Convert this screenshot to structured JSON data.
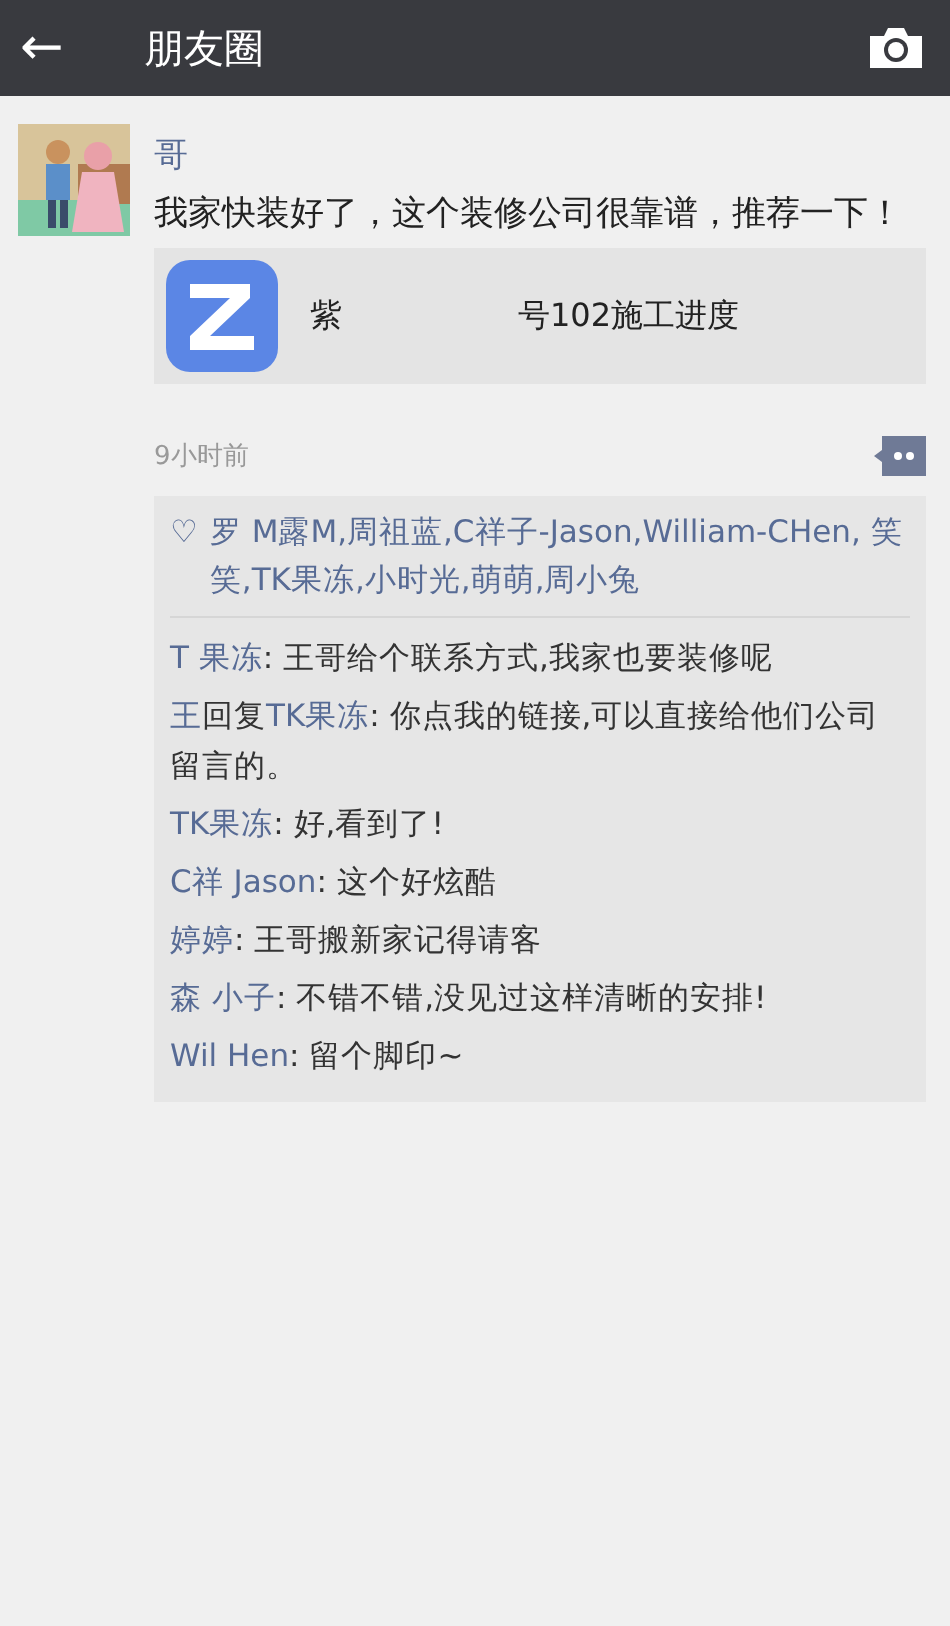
{
  "header": {
    "back": "←",
    "title": "朋友圈"
  },
  "post": {
    "author": "哥",
    "text": "我家快装好了，这个装修公司很靠谱，推荐一下！",
    "link": {
      "title_parts": [
        "紫",
        "号102施工进度"
      ]
    },
    "time": "9小时前"
  },
  "likes": {
    "icon": "♡",
    "names": "罗 M露M,周祖蓝,C祥子-Jason,William-CHen, 笑笑,TK果冻,小时光,萌萌,周小兔"
  },
  "comments": [
    {
      "name": "T 果冻",
      "text": ": 王哥给个联系方式,我家也要装修呢"
    },
    {
      "name": "王",
      "reply_word": "回复",
      "reply_to": "TK果冻",
      "text": ": 你点我的链接,可以直接给他们公司留言的。"
    },
    {
      "name": "TK果冻",
      "text": ": 好,看到了!"
    },
    {
      "name": "C祥 Jason",
      "text": ": 这个好炫酷"
    },
    {
      "name": "婷婷",
      "text": ": 王哥搬新家记得请客"
    },
    {
      "name": "森 小子",
      "text": ": 不错不错,没见过这样清晰的安排!"
    },
    {
      "name": "Wil Hen",
      "text": ": 留个脚印~"
    }
  ]
}
